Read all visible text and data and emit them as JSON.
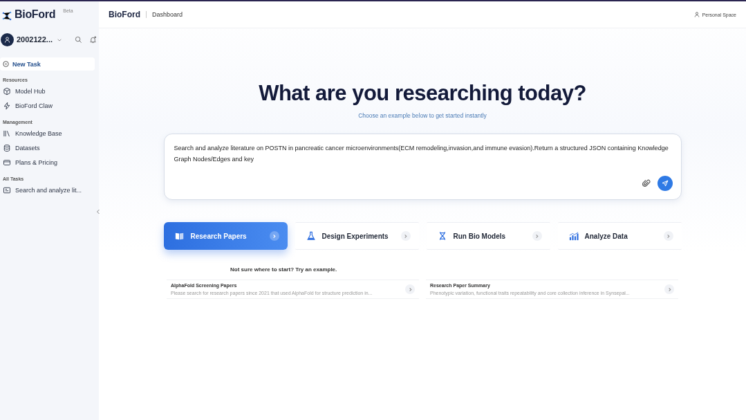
{
  "sidebar": {
    "brand": "BioFord",
    "badge": "Beta",
    "user": "2002122...",
    "new_task": "New Task",
    "sections": [
      {
        "title": "Resources",
        "items": [
          {
            "label": "Model Hub",
            "kind": "cube"
          },
          {
            "label": "BioFord Claw",
            "kind": "bolt"
          }
        ]
      },
      {
        "title": "Management",
        "items": [
          {
            "label": "Knowledge Base",
            "kind": "books"
          },
          {
            "label": "Datasets",
            "kind": "database"
          },
          {
            "label": "Plans & Pricing",
            "kind": "card"
          }
        ]
      },
      {
        "title": "All Tasks",
        "items": [
          {
            "label": "Search and analyze lit...",
            "kind": "task"
          }
        ]
      }
    ]
  },
  "header": {
    "brand": "BioFord",
    "page": "Dashboard",
    "space": "Personal Space"
  },
  "hero": {
    "title": "What are you researching today?",
    "subtitle": "Choose an example below to get started instantly"
  },
  "prompt": {
    "value": "Search and analyze literature on POSTN in pancreatic cancer microenvironments(ECM remodeling,invasion,and immune evasion).Return a structured JSON containing Knowledge Graph Nodes/Edges and key"
  },
  "modes": [
    {
      "label": "Research Papers",
      "kind": "book",
      "selected": true
    },
    {
      "label": "Design Experiments",
      "kind": "flask",
      "selected": false
    },
    {
      "label": "Run Bio Models",
      "kind": "dna",
      "selected": false
    },
    {
      "label": "Analyze Data",
      "kind": "chart",
      "selected": false
    }
  ],
  "examples_title": "Not sure where to start? Try an example.",
  "examples": [
    {
      "title": "AlphaFold Screening Papers",
      "text": "Please search for research papers since 2021 that used AlphaFold for structure prediction in..."
    },
    {
      "title": "Research Paper Summary",
      "text": "Phenotypic variation, functional traits repeatability and core collection inference in Synsepal..."
    }
  ]
}
